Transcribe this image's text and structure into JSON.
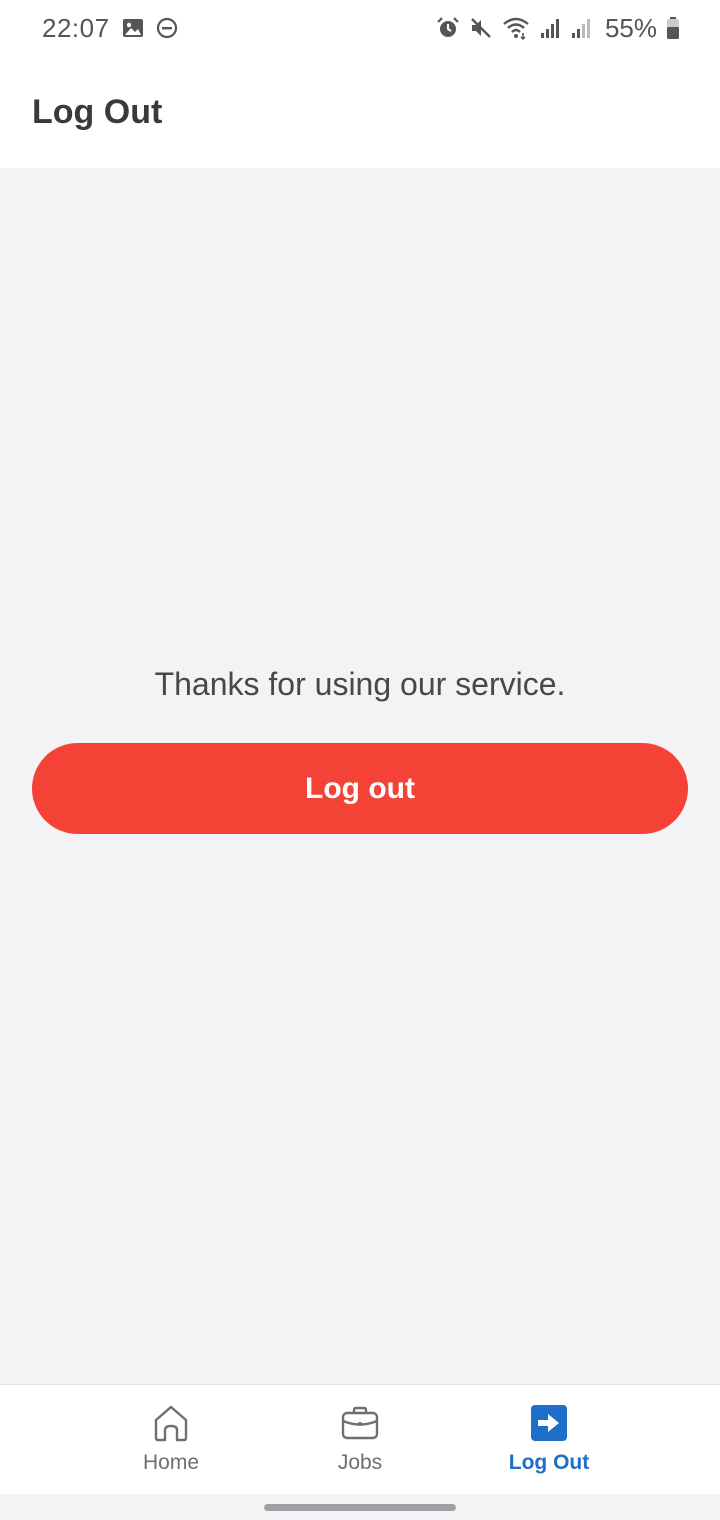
{
  "status_bar": {
    "time": "22:07",
    "battery_percent": "55%",
    "left_icons": [
      "image-icon",
      "do-not-disturb-icon"
    ],
    "right_icons": [
      "alarm-icon",
      "mute-icon",
      "wifi-icon",
      "signal-icon",
      "signal-icon-2",
      "battery-icon"
    ]
  },
  "header": {
    "title": "Log Out"
  },
  "main": {
    "message": "Thanks for using our service.",
    "logout_button_label": "Log out",
    "logout_button_color": "#f44236"
  },
  "tab_bar": {
    "tabs": [
      {
        "label": "Home",
        "icon": "home-icon",
        "active": false
      },
      {
        "label": "Jobs",
        "icon": "briefcase-icon",
        "active": false
      },
      {
        "label": "Log Out",
        "icon": "logout-arrow-icon",
        "active": true
      }
    ],
    "active_color": "#1f6fc8"
  }
}
